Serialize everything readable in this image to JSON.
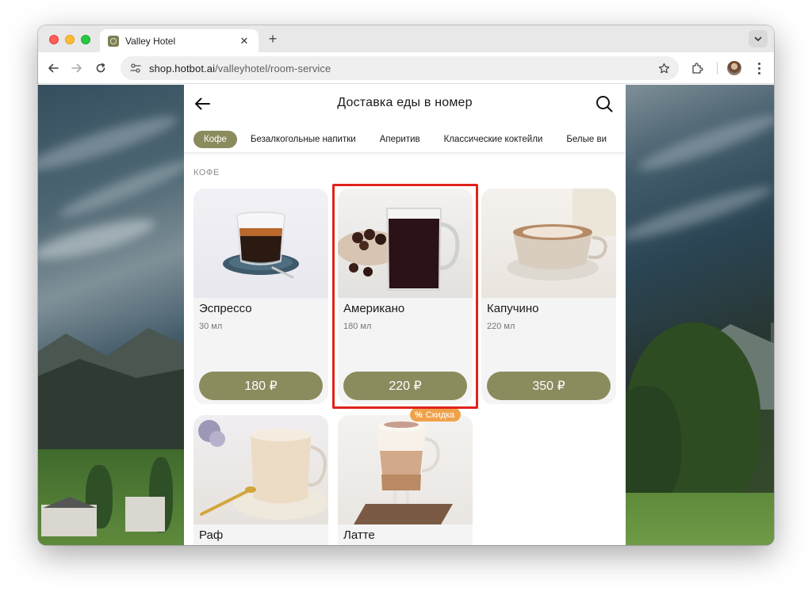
{
  "browser": {
    "tab_title": "Valley Hotel",
    "tab_close": "✕",
    "new_tab": "+",
    "url_host": "shop.hotbot.ai",
    "url_path": "/valleyhotel/room-service"
  },
  "app": {
    "title": "Доставка еды в номер",
    "categories": [
      {
        "label": "Кофе",
        "active": true
      },
      {
        "label": "Безалкогольные напитки"
      },
      {
        "label": "Аперитив"
      },
      {
        "label": "Классические коктейли"
      },
      {
        "label": "Белые ви"
      }
    ],
    "section_title": "КОФЕ",
    "products": [
      {
        "name": "Эспрессо",
        "volume": "30 мл",
        "price": "180 ₽"
      },
      {
        "name": "Американо",
        "volume": "180 мл",
        "price": "220 ₽"
      },
      {
        "name": "Капучино",
        "volume": "220 мл",
        "price": "350 ₽"
      },
      {
        "name": "Раф"
      },
      {
        "name": "Латте",
        "badge": "Скидка",
        "badge_symbol": "%"
      }
    ],
    "accent_color": "#8a8c5e",
    "badge_color": "#f0a24a",
    "highlight_color": "#e0231a"
  },
  "icons": {
    "back": "arrow-left-icon",
    "search": "search-icon",
    "star": "star-icon",
    "extensions": "puzzle-icon"
  }
}
